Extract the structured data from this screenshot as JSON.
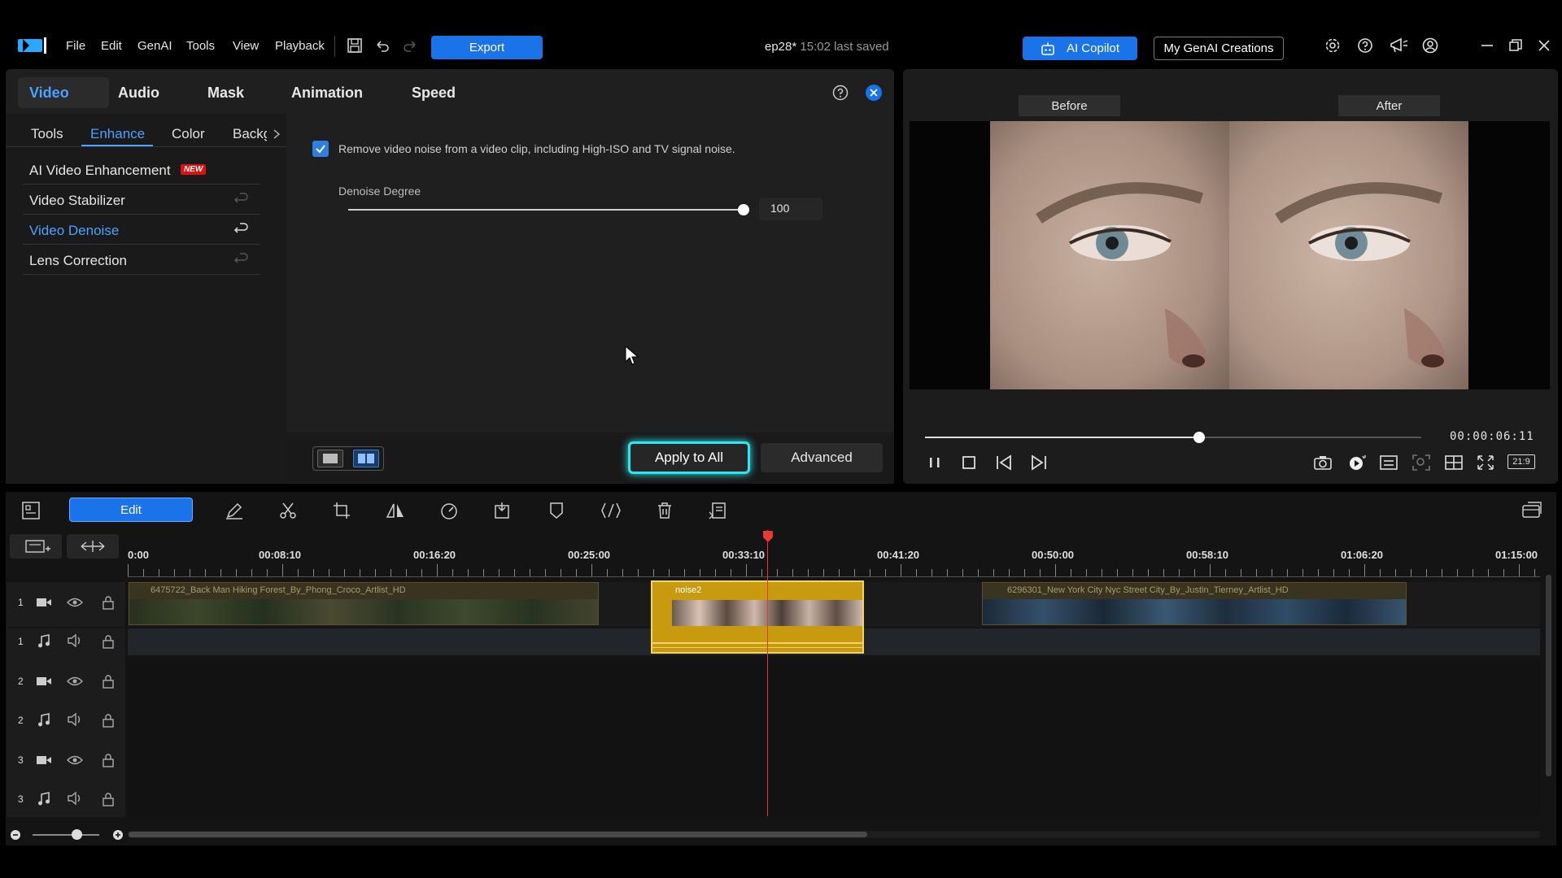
{
  "menu": {
    "file": "File",
    "edit": "Edit",
    "genai": "GenAI",
    "tools": "Tools",
    "view": "View",
    "playback": "Playback"
  },
  "header": {
    "export_label": "Export",
    "project_name": "ep28*",
    "saved_status": "15:02 last saved",
    "ai_copilot_label": "AI Copilot",
    "genai_creations_label": "My GenAI Creations"
  },
  "panel": {
    "main_tabs": [
      "Video",
      "Audio",
      "Mask",
      "Animation",
      "Speed"
    ],
    "sub_tabs": [
      "Tools",
      "Enhance",
      "Color",
      "Backg"
    ],
    "active_main_tab": "Video",
    "active_sub_tab": "Enhance",
    "fx_items": [
      {
        "label": "AI Video Enhancement",
        "badge": "NEW",
        "active": false
      },
      {
        "label": "Video Stabilizer",
        "active": false
      },
      {
        "label": "Video Denoise",
        "active": true
      },
      {
        "label": "Lens Correction",
        "active": false
      }
    ],
    "denoise": {
      "checkbox_label": "Remove video noise from a video clip, including High-ISO and TV signal noise.",
      "checked": true,
      "degree_label": "Denoise Degree",
      "degree_value": "100",
      "degree_fraction": 1.0
    },
    "apply_all_label": "Apply to All",
    "advanced_label": "Advanced"
  },
  "preview": {
    "before_label": "Before",
    "after_label": "After",
    "timecode": "00:00:06:11",
    "progress_fraction": 0.553,
    "aspect_label": "21:9"
  },
  "timeline": {
    "edit_label": "Edit",
    "ruler": [
      "0:00",
      "00:08:10",
      "00:16:20",
      "00:25:00",
      "00:33:10",
      "00:41:20",
      "00:50:00",
      "00:58:10",
      "01:06:20",
      "01:15:00"
    ],
    "tracks": [
      {
        "num": "1",
        "type": "video"
      },
      {
        "num": "1",
        "type": "audio"
      },
      {
        "num": "2",
        "type": "video"
      },
      {
        "num": "2",
        "type": "audio"
      },
      {
        "num": "3",
        "type": "video"
      },
      {
        "num": "3",
        "type": "audio"
      }
    ],
    "clips": {
      "clip1": "6475722_Back Man Hiking Forest_By_Phong_Croco_Artlist_HD",
      "clip2": "noise2",
      "clip3": "6296301_New York City Nyc Street City_By_Justin_Tierney_Artlist_HD"
    }
  },
  "colors": {
    "accent_blue": "#1a73e8",
    "selected_clip": "#c79a10",
    "playhead": "#e53935",
    "apply_glow": "#2fe6f0"
  }
}
